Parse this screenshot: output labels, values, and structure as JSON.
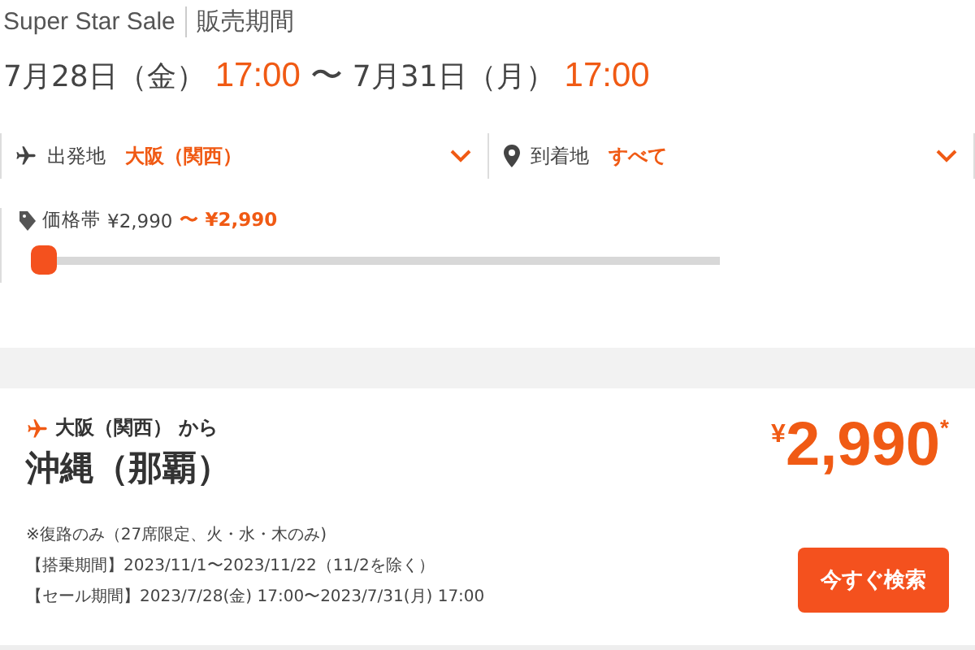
{
  "header": {
    "title": "Super Star Sale",
    "subtitle": "販売期間"
  },
  "period": {
    "start_date": "7月28日（金）",
    "start_time": "17:00",
    "separator": "〜",
    "end_date": "7月31日（月）",
    "end_time": "17:00"
  },
  "filters": [
    {
      "kind": "departure",
      "label": "出発地",
      "value": "大阪（関西）"
    },
    {
      "kind": "arrival",
      "label": "到着地",
      "value": "すべて"
    }
  ],
  "price_range": {
    "label": "価格帯",
    "min": "¥2,990",
    "separator": "〜",
    "max": "¥2,990",
    "level": 0
  },
  "deal": {
    "origin": "大阪（関西） から",
    "destination": "沖縄（那覇）",
    "currency": "¥",
    "price": "2,990",
    "price_note": "*",
    "notes": [
      "※復路のみ（27席限定、火・水・木のみ)",
      "【搭乗期間】2023/11/1〜2023/11/22（11/2を除く）",
      "【セール期間】2023/7/28(金) 17:00〜2023/7/31(月) 17:00"
    ],
    "button": "今すぐ検索"
  }
}
